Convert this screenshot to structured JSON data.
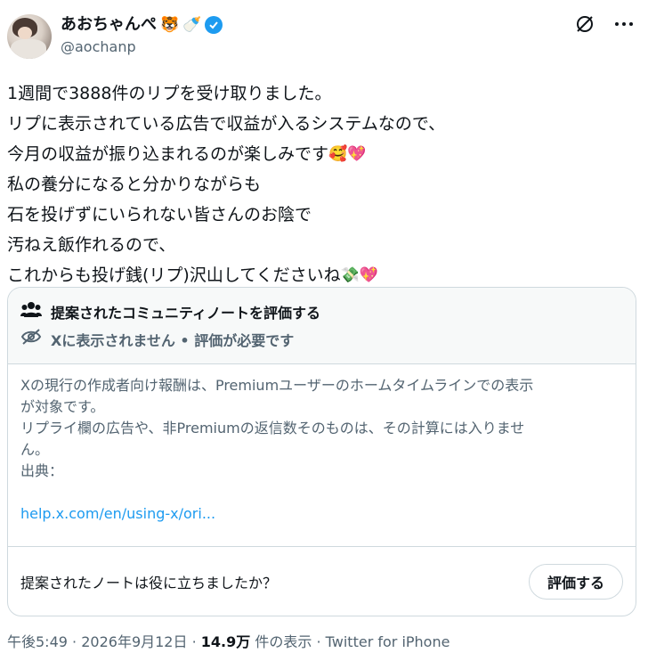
{
  "author": {
    "display_name": "あおちゃんぺ",
    "name_emojis": [
      "🐯",
      "🍼"
    ],
    "handle": "@aochanp"
  },
  "tweet": {
    "lines": [
      "1週間で3888件のリプを受け取りました。",
      "リプに表示されている広告で収益が入るシステムなので、",
      "今月の収益が振り込まれるのが楽しみです",
      "私の養分になると分かりながらも",
      "石を投げずにいられない皆さんのお陰で",
      "汚ねえ飯作れるので、",
      "これからも投げ銭(リプ)沢山してくださいね"
    ],
    "emoji_line3": "🥰💖",
    "emoji_line7": "💸💖"
  },
  "community_note": {
    "title": "提案されたコミュニティノートを評価する",
    "status": "Xに表示されません • 評価が必要です",
    "body_lines": [
      "Xの現行の作成者向け報酬は、Premiumユーザーのホームタイムラインでの表示",
      "が対象です。",
      "リプライ欄の広告や、非Premiumの返信数そのものは、その計算には入りませ",
      "ん。",
      "出典："
    ],
    "link": "help.x.com/en/using-x/ori...",
    "question": "提案されたノートは役に立ちましたか？",
    "rate_label": "評価する"
  },
  "meta": {
    "time": "午後5:49",
    "date": "2026年9月12日",
    "views": "14.9万",
    "views_suffix": "件の表示",
    "client": "Twitter for iPhone",
    "sep": "·"
  },
  "colors": {
    "accent": "#1d9bf0",
    "text": "#0f1419",
    "secondary": "#536471",
    "border": "#cfd9de"
  }
}
